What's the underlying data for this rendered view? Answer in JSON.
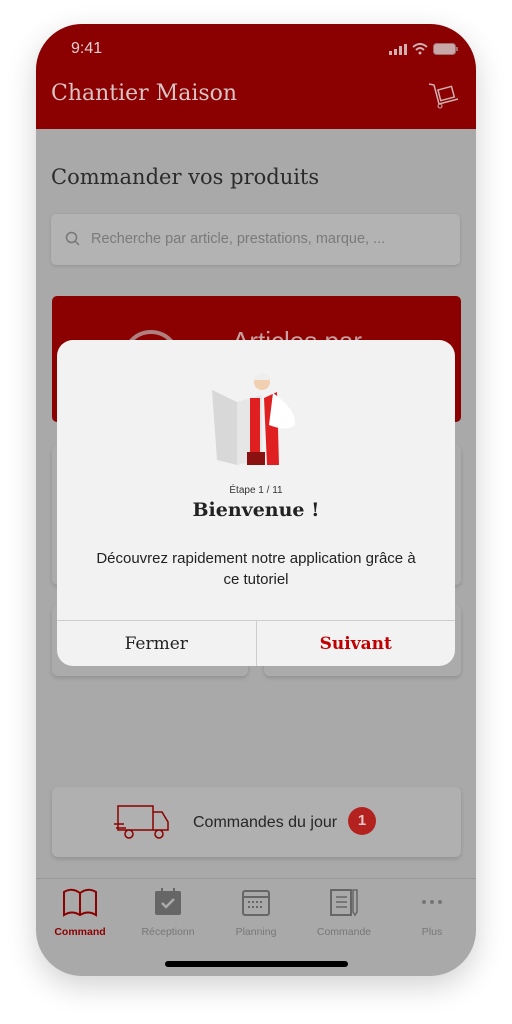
{
  "status_bar": {
    "time": "9:41"
  },
  "header": {
    "title": "Chantier Maison",
    "cart_icon": "hand-truck-cart-icon"
  },
  "main": {
    "title": "Commander vos produits",
    "search": {
      "placeholder": "Recherche par article, prestations, marque, ..."
    },
    "featured_card": {
      "label": "Articles par"
    },
    "daily_orders": {
      "label": "Commandes du jour",
      "count": "1"
    }
  },
  "tutorial": {
    "step": "Étape 1 / 11",
    "title": "Bienvenue !",
    "description": "Découvrez rapidement notre application grâce à ce tutoriel",
    "close_label": "Fermer",
    "next_label": "Suivant"
  },
  "tabbar": {
    "items": [
      {
        "label": "Command",
        "icon": "open-book-icon",
        "active": true
      },
      {
        "label": "Réceptionn",
        "icon": "calendar-check-icon"
      },
      {
        "label": "Planning",
        "icon": "calendar-grid-icon"
      },
      {
        "label": "Commande",
        "icon": "checklist-pencil-icon"
      },
      {
        "label": "Plus",
        "icon": "more-dots-icon"
      }
    ]
  },
  "colors": {
    "brand": "#8b0000",
    "accent": "#c00000",
    "badge": "#b3221f"
  }
}
